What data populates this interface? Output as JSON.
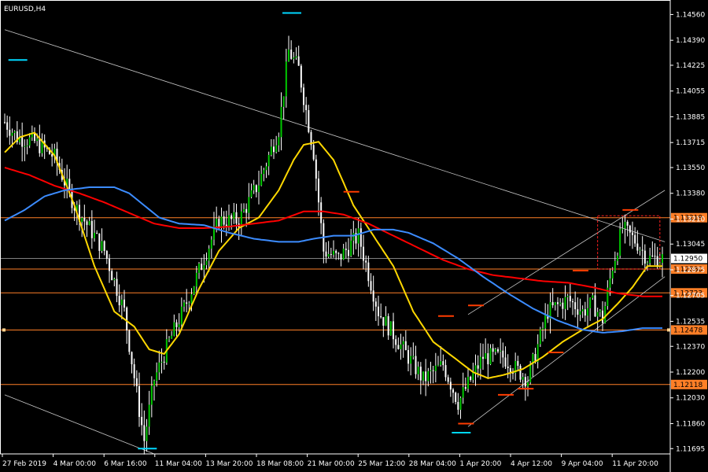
{
  "chart_data": {
    "type": "candlestick",
    "title": "EURUSD,H4",
    "ylim": [
      1.1166,
      1.14635
    ],
    "y_ticks": [
      "1.14560",
      "1.14390",
      "1.14225",
      "1.14055",
      "1.13885",
      "1.13715",
      "1.13550",
      "1.13380",
      "1.13210",
      "1.13045",
      "1.12875",
      "1.12705",
      "1.12535",
      "1.12370",
      "1.12200",
      "1.12030",
      "1.11860",
      "1.11695"
    ],
    "x_labels": [
      "27 Feb 2019",
      "4 Mar 00:00",
      "6 Mar 16:00",
      "11 Mar 04:00",
      "13 Mar 20:00",
      "18 Mar 08:00",
      "21 Mar 00:00",
      "25 Mar 12:00",
      "28 Mar 04:00",
      "1 Apr 20:00",
      "4 Apr 12:00",
      "9 Apr 04:00",
      "11 Apr 20:00"
    ],
    "current_price": "1.12950",
    "horizontal_levels": [
      {
        "value": 1.13219,
        "label": "1.13219",
        "color": "#ff7f27"
      },
      {
        "value": 1.1288,
        "label": "1.12880",
        "color": "#ff7f27"
      },
      {
        "value": 1.12723,
        "label": "1.12723",
        "color": "#ff7f27"
      },
      {
        "value": 1.12478,
        "label": "1.12478",
        "color": "#ff7f27"
      },
      {
        "value": 1.12118,
        "label": "1.12118",
        "color": "#ff7f27"
      }
    ],
    "close_path": [
      [
        0,
        1.1385
      ],
      [
        5,
        1.1375
      ],
      [
        12,
        1.1372
      ],
      [
        20,
        1.1362
      ],
      [
        28,
        1.133
      ],
      [
        34,
        1.1315
      ],
      [
        40,
        1.13
      ],
      [
        48,
        1.126
      ],
      [
        54,
        1.1195
      ],
      [
        56,
        1.1175
      ],
      [
        60,
        1.1215
      ],
      [
        66,
        1.124
      ],
      [
        72,
        1.1262
      ],
      [
        80,
        1.1295
      ],
      [
        86,
        1.132
      ],
      [
        94,
        1.132
      ],
      [
        102,
        1.1345
      ],
      [
        110,
        1.138
      ],
      [
        114,
        1.1432
      ],
      [
        118,
        1.142
      ],
      [
        124,
        1.1365
      ],
      [
        128,
        1.13
      ],
      [
        134,
        1.1295
      ],
      [
        142,
        1.131
      ],
      [
        150,
        1.126
      ],
      [
        160,
        1.1235
      ],
      [
        168,
        1.1215
      ],
      [
        176,
        1.1225
      ],
      [
        182,
        1.12
      ],
      [
        186,
        1.1212
      ],
      [
        192,
        1.123
      ],
      [
        200,
        1.123
      ],
      [
        210,
        1.1215
      ],
      [
        218,
        1.126
      ],
      [
        226,
        1.1268
      ],
      [
        232,
        1.126
      ],
      [
        236,
        1.1265
      ],
      [
        240,
        1.1255
      ],
      [
        244,
        1.129
      ],
      [
        248,
        1.1315
      ],
      [
        254,
        1.1305
      ],
      [
        258,
        1.1295
      ]
    ],
    "series": [
      {
        "name": "",
        "color": "#ffd800",
        "values": [
          [
            0,
            1.1365
          ],
          [
            6,
            1.1375
          ],
          [
            12,
            1.1378
          ],
          [
            20,
            1.1363
          ],
          [
            28,
            1.133
          ],
          [
            36,
            1.129
          ],
          [
            44,
            1.126
          ],
          [
            52,
            1.125
          ],
          [
            58,
            1.1235
          ],
          [
            64,
            1.1232
          ],
          [
            70,
            1.1245
          ],
          [
            78,
            1.1275
          ],
          [
            86,
            1.13
          ],
          [
            94,
            1.1315
          ],
          [
            102,
            1.1322
          ],
          [
            110,
            1.134
          ],
          [
            116,
            1.136
          ],
          [
            120,
            1.137
          ],
          [
            126,
            1.1372
          ],
          [
            132,
            1.136
          ],
          [
            140,
            1.133
          ],
          [
            148,
            1.131
          ],
          [
            156,
            1.129
          ],
          [
            164,
            1.126
          ],
          [
            172,
            1.124
          ],
          [
            180,
            1.123
          ],
          [
            188,
            1.122
          ],
          [
            194,
            1.1216
          ],
          [
            200,
            1.1218
          ],
          [
            208,
            1.1222
          ],
          [
            216,
            1.123
          ],
          [
            224,
            1.124
          ],
          [
            232,
            1.1248
          ],
          [
            240,
            1.1255
          ],
          [
            246,
            1.1265
          ],
          [
            252,
            1.1276
          ],
          [
            258,
            1.129
          ]
        ]
      },
      {
        "name": "",
        "color": "#ff0000",
        "values": [
          [
            0,
            1.1355
          ],
          [
            10,
            1.135
          ],
          [
            20,
            1.1343
          ],
          [
            30,
            1.1338
          ],
          [
            40,
            1.1332
          ],
          [
            50,
            1.1325
          ],
          [
            60,
            1.1318
          ],
          [
            70,
            1.1315
          ],
          [
            80,
            1.1315
          ],
          [
            90,
            1.1316
          ],
          [
            100,
            1.1318
          ],
          [
            110,
            1.132
          ],
          [
            120,
            1.1326
          ],
          [
            128,
            1.1326
          ],
          [
            136,
            1.1324
          ],
          [
            146,
            1.1318
          ],
          [
            156,
            1.131
          ],
          [
            166,
            1.1302
          ],
          [
            176,
            1.1294
          ],
          [
            186,
            1.1288
          ],
          [
            196,
            1.1284
          ],
          [
            206,
            1.1282
          ],
          [
            216,
            1.128
          ],
          [
            226,
            1.1279
          ],
          [
            236,
            1.1276
          ],
          [
            246,
            1.1272
          ],
          [
            256,
            1.127
          ]
        ]
      },
      {
        "name": "",
        "color": "#3c8cff",
        "values": [
          [
            0,
            1.132
          ],
          [
            8,
            1.1327
          ],
          [
            16,
            1.1336
          ],
          [
            24,
            1.134
          ],
          [
            34,
            1.1342
          ],
          [
            44,
            1.1342
          ],
          [
            50,
            1.1338
          ],
          [
            56,
            1.133
          ],
          [
            62,
            1.1322
          ],
          [
            70,
            1.1318
          ],
          [
            80,
            1.1317
          ],
          [
            90,
            1.1312
          ],
          [
            100,
            1.1308
          ],
          [
            110,
            1.1306
          ],
          [
            118,
            1.1306
          ],
          [
            124,
            1.1308
          ],
          [
            132,
            1.131
          ],
          [
            140,
            1.131
          ],
          [
            148,
            1.1314
          ],
          [
            156,
            1.1314
          ],
          [
            162,
            1.1312
          ],
          [
            172,
            1.1305
          ],
          [
            182,
            1.1295
          ],
          [
            192,
            1.1283
          ],
          [
            202,
            1.1272
          ],
          [
            212,
            1.1262
          ],
          [
            222,
            1.1254
          ],
          [
            232,
            1.1248
          ],
          [
            240,
            1.1246
          ],
          [
            248,
            1.1247
          ],
          [
            256,
            1.1249
          ]
        ]
      }
    ],
    "trendlines": [
      {
        "from": [
          0,
          1.1446
        ],
        "to": [
          265,
          1.1306
        ],
        "color": "#c8c8c8"
      },
      {
        "from": [
          0,
          1.1205
        ],
        "to": [
          60,
          1.1166
        ],
        "color": "#c8c8c8"
      },
      {
        "from": [
          186,
          1.1184
        ],
        "to": [
          265,
          1.1283
        ],
        "color": "#c8c8c8"
      },
      {
        "from": [
          186,
          1.1258
        ],
        "to": [
          265,
          1.134
        ],
        "color": "#c8c8c8"
      }
    ]
  }
}
